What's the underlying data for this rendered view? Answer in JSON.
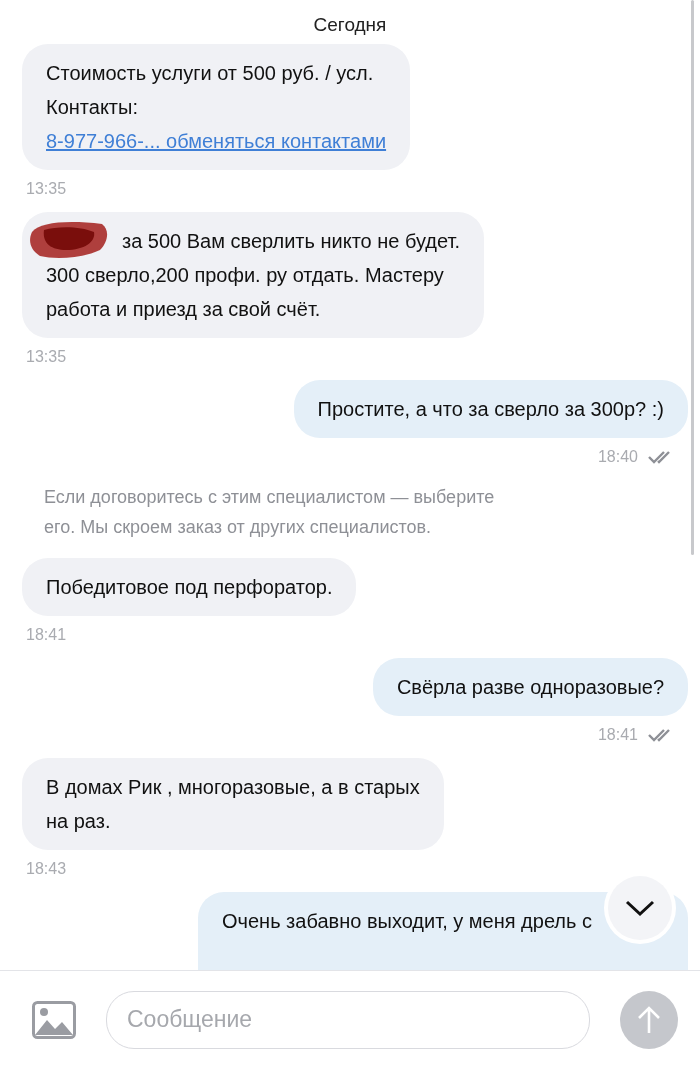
{
  "date_divider": "Сегодня",
  "messages": [
    {
      "kind": "incoming",
      "text": "Стоимость услуги от 500 руб. / усл.\nКонтакты:",
      "link": "8-977-966-... обменяться контактами",
      "time": "13:35"
    },
    {
      "kind": "incoming",
      "redacted": true,
      "text": "за 500 Вам сверлить никто не будет.\n300 сверло,200 профи. ру отдать. Мастеру\nработа и приезд за свой счёт.",
      "time": "13:35"
    },
    {
      "kind": "outgoing",
      "text": "Простите, а что за сверло за 300р? :)",
      "time": "18:40",
      "read": true
    },
    {
      "kind": "system",
      "text": "Если договоритесь с этим специалистом — выберите\nего. Мы скроем заказ от других специалистов."
    },
    {
      "kind": "incoming",
      "text": "Победитовое под перфоратор.",
      "time": "18:41"
    },
    {
      "kind": "outgoing",
      "text": "Свёрла разве одноразовые?",
      "time": "18:41",
      "read": true
    },
    {
      "kind": "incoming",
      "text": "В домах Рик , многоразовые, а в старых\nна раз.",
      "time": "18:43"
    },
    {
      "kind": "outgoing",
      "text": "Очень забавно выходит, у меня дрель с"
    }
  ],
  "composer": {
    "placeholder": "Сообщение"
  }
}
